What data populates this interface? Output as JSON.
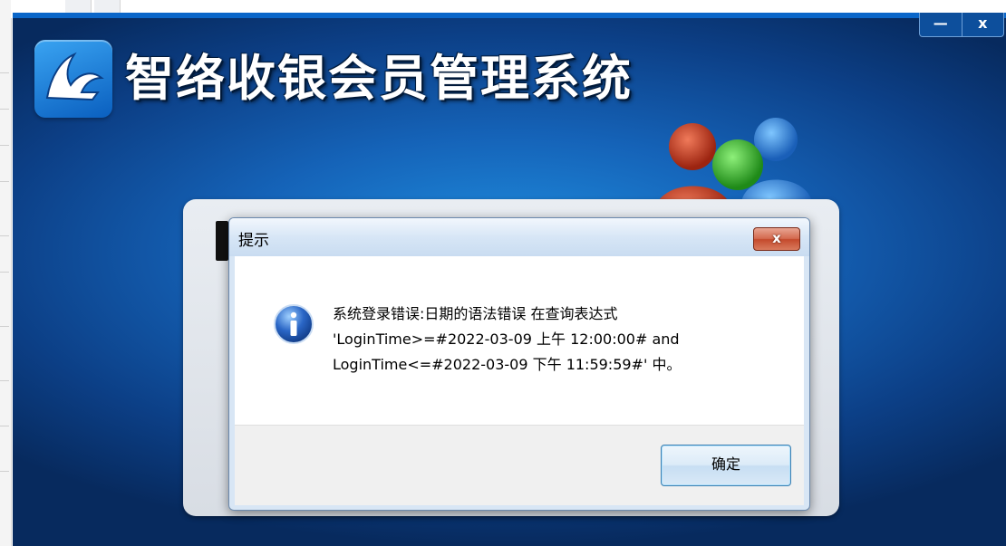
{
  "app": {
    "title": "智络收银会员管理系统",
    "minimize_label": "—",
    "close_label": "x"
  },
  "dialog": {
    "title": "提示",
    "close_label": "x",
    "message_lines": [
      "系统登录错误:日期的语法错误 在查询表达式",
      "'LoginTime>=#2022-03-09 上午 12:00:00# and",
      "LoginTime<=#2022-03-09 下午 11:59:59#' 中。"
    ],
    "ok_label": "确定",
    "icon": "information-icon"
  },
  "colors": {
    "background_blue": "#1563b8",
    "dialog_close_red": "#c44a2c",
    "info_icon_blue": "#2a66c6"
  }
}
